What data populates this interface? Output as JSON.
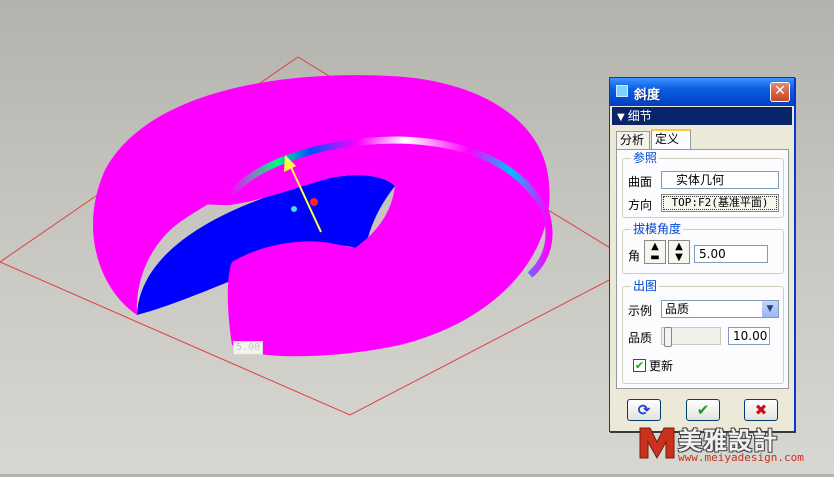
{
  "viewport": {
    "dimension_label": "5.00"
  },
  "dialog": {
    "title": "斜度",
    "close_glyph": "✕",
    "section": "细节",
    "tabs": [
      "分析",
      "定义"
    ],
    "reference": {
      "legend": "参照",
      "surface_label": "曲面",
      "surface_value": "实体几何",
      "direction_label": "方向",
      "direction_value": "TOP:F2(基准平面)"
    },
    "draft_angle": {
      "legend": "拔模角度",
      "angle_label": "角",
      "angle_value": "5.00"
    },
    "output": {
      "legend": "出图",
      "example_label": "示例",
      "example_value": "品质",
      "quality_label": "品质",
      "quality_value": "10.00",
      "update_label": "更新",
      "update_checked": true
    },
    "buttons": {
      "repaint_glyph": "⟳",
      "ok_glyph": "✔",
      "cancel_glyph": "✖"
    }
  },
  "watermark": {
    "title": "美雅設計",
    "url": "www.meiyadesign.com"
  }
}
